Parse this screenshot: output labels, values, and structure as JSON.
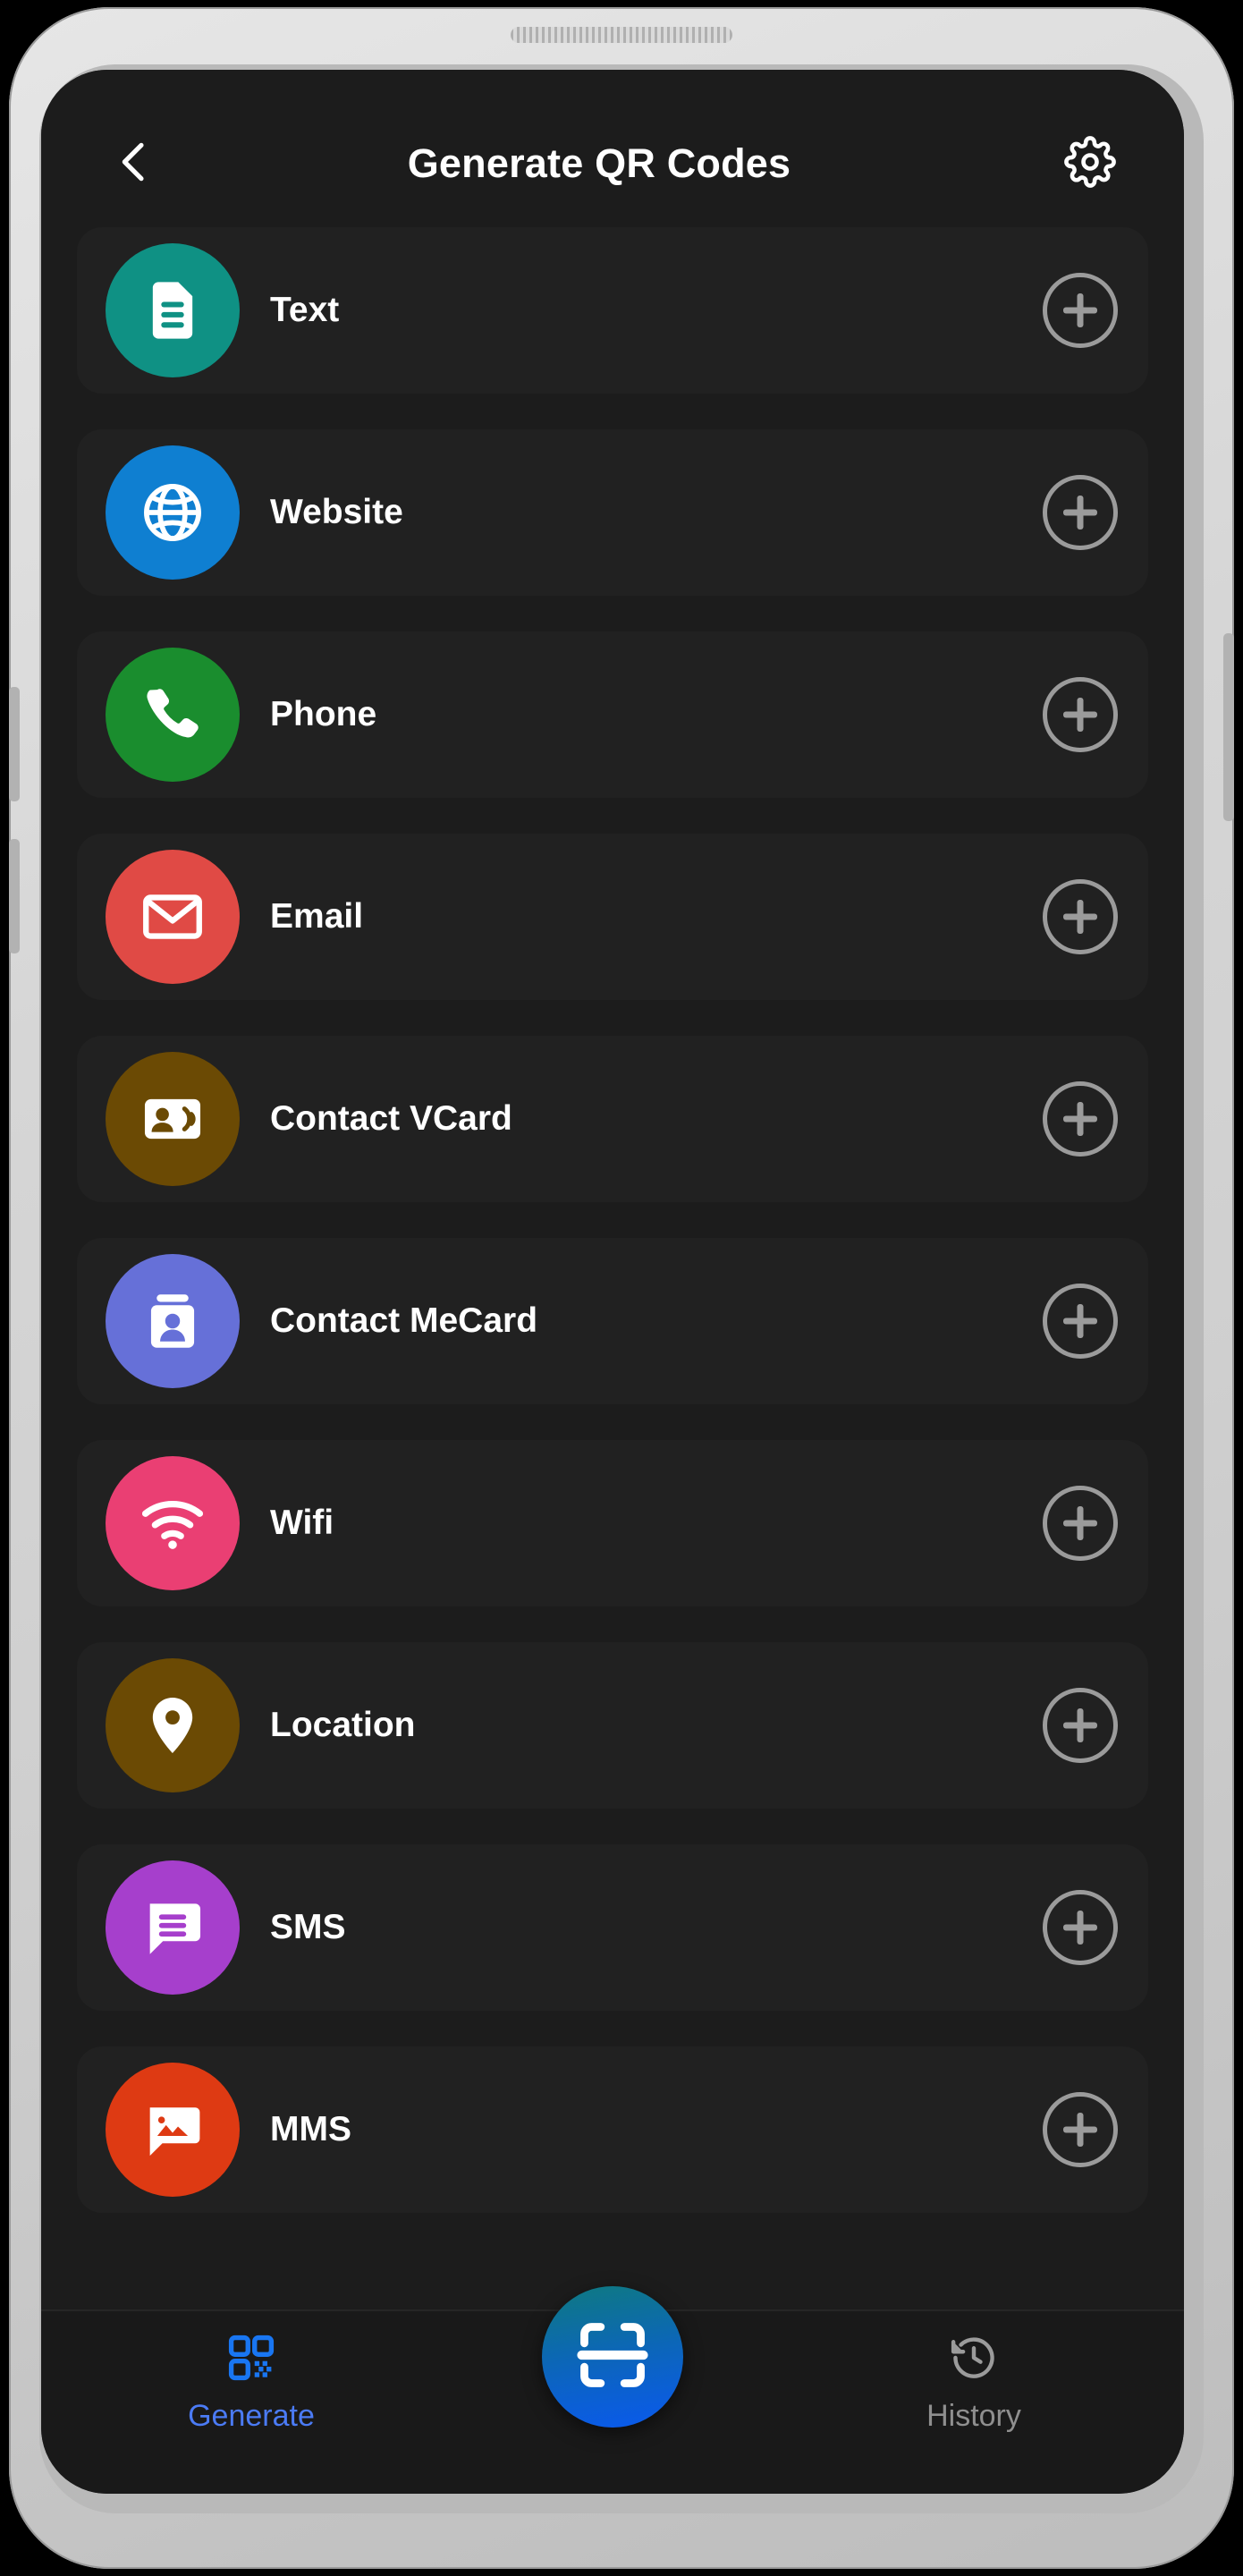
{
  "app": {
    "title": "Generate QR Codes",
    "back_icon": "chevron-left-icon",
    "settings_icon": "gear-icon"
  },
  "colors": {
    "screen_bg": "#1c1c1c",
    "row_bg": "#212121",
    "accent": "#4b7bf5",
    "inactive": "#8f8f8f",
    "add_button": "#9b9b9b"
  },
  "list": {
    "add_icon": "plus-circle-icon",
    "items": [
      {
        "label": "Text",
        "icon": "document-icon",
        "color": "#0f9184"
      },
      {
        "label": "Website",
        "icon": "globe-icon",
        "color": "#0f7fd1"
      },
      {
        "label": "Phone",
        "icon": "phone-icon",
        "color": "#1a8d2e"
      },
      {
        "label": "Email",
        "icon": "envelope-icon",
        "color": "#e04a45"
      },
      {
        "label": "Contact VCard",
        "icon": "contact-card-icon",
        "color": "#6b4a04"
      },
      {
        "label": "Contact MeCard",
        "icon": "id-badge-icon",
        "color": "#6670d8"
      },
      {
        "label": "Wifi",
        "icon": "wifi-icon",
        "color": "#ea3f73"
      },
      {
        "label": "Location",
        "icon": "map-pin-icon",
        "color": "#6b4a04"
      },
      {
        "label": "SMS",
        "icon": "chat-bubble-icon",
        "color": "#a63fcc"
      },
      {
        "label": "MMS",
        "icon": "image-message-icon",
        "color": "#de3a13"
      }
    ]
  },
  "bottom_nav": {
    "tabs": [
      {
        "label": "Generate",
        "icon": "qr-code-icon",
        "active": true
      },
      {
        "label": "History",
        "icon": "history-clock-icon",
        "active": false
      }
    ],
    "fab": {
      "icon": "scan-icon",
      "label": "Scan"
    }
  }
}
